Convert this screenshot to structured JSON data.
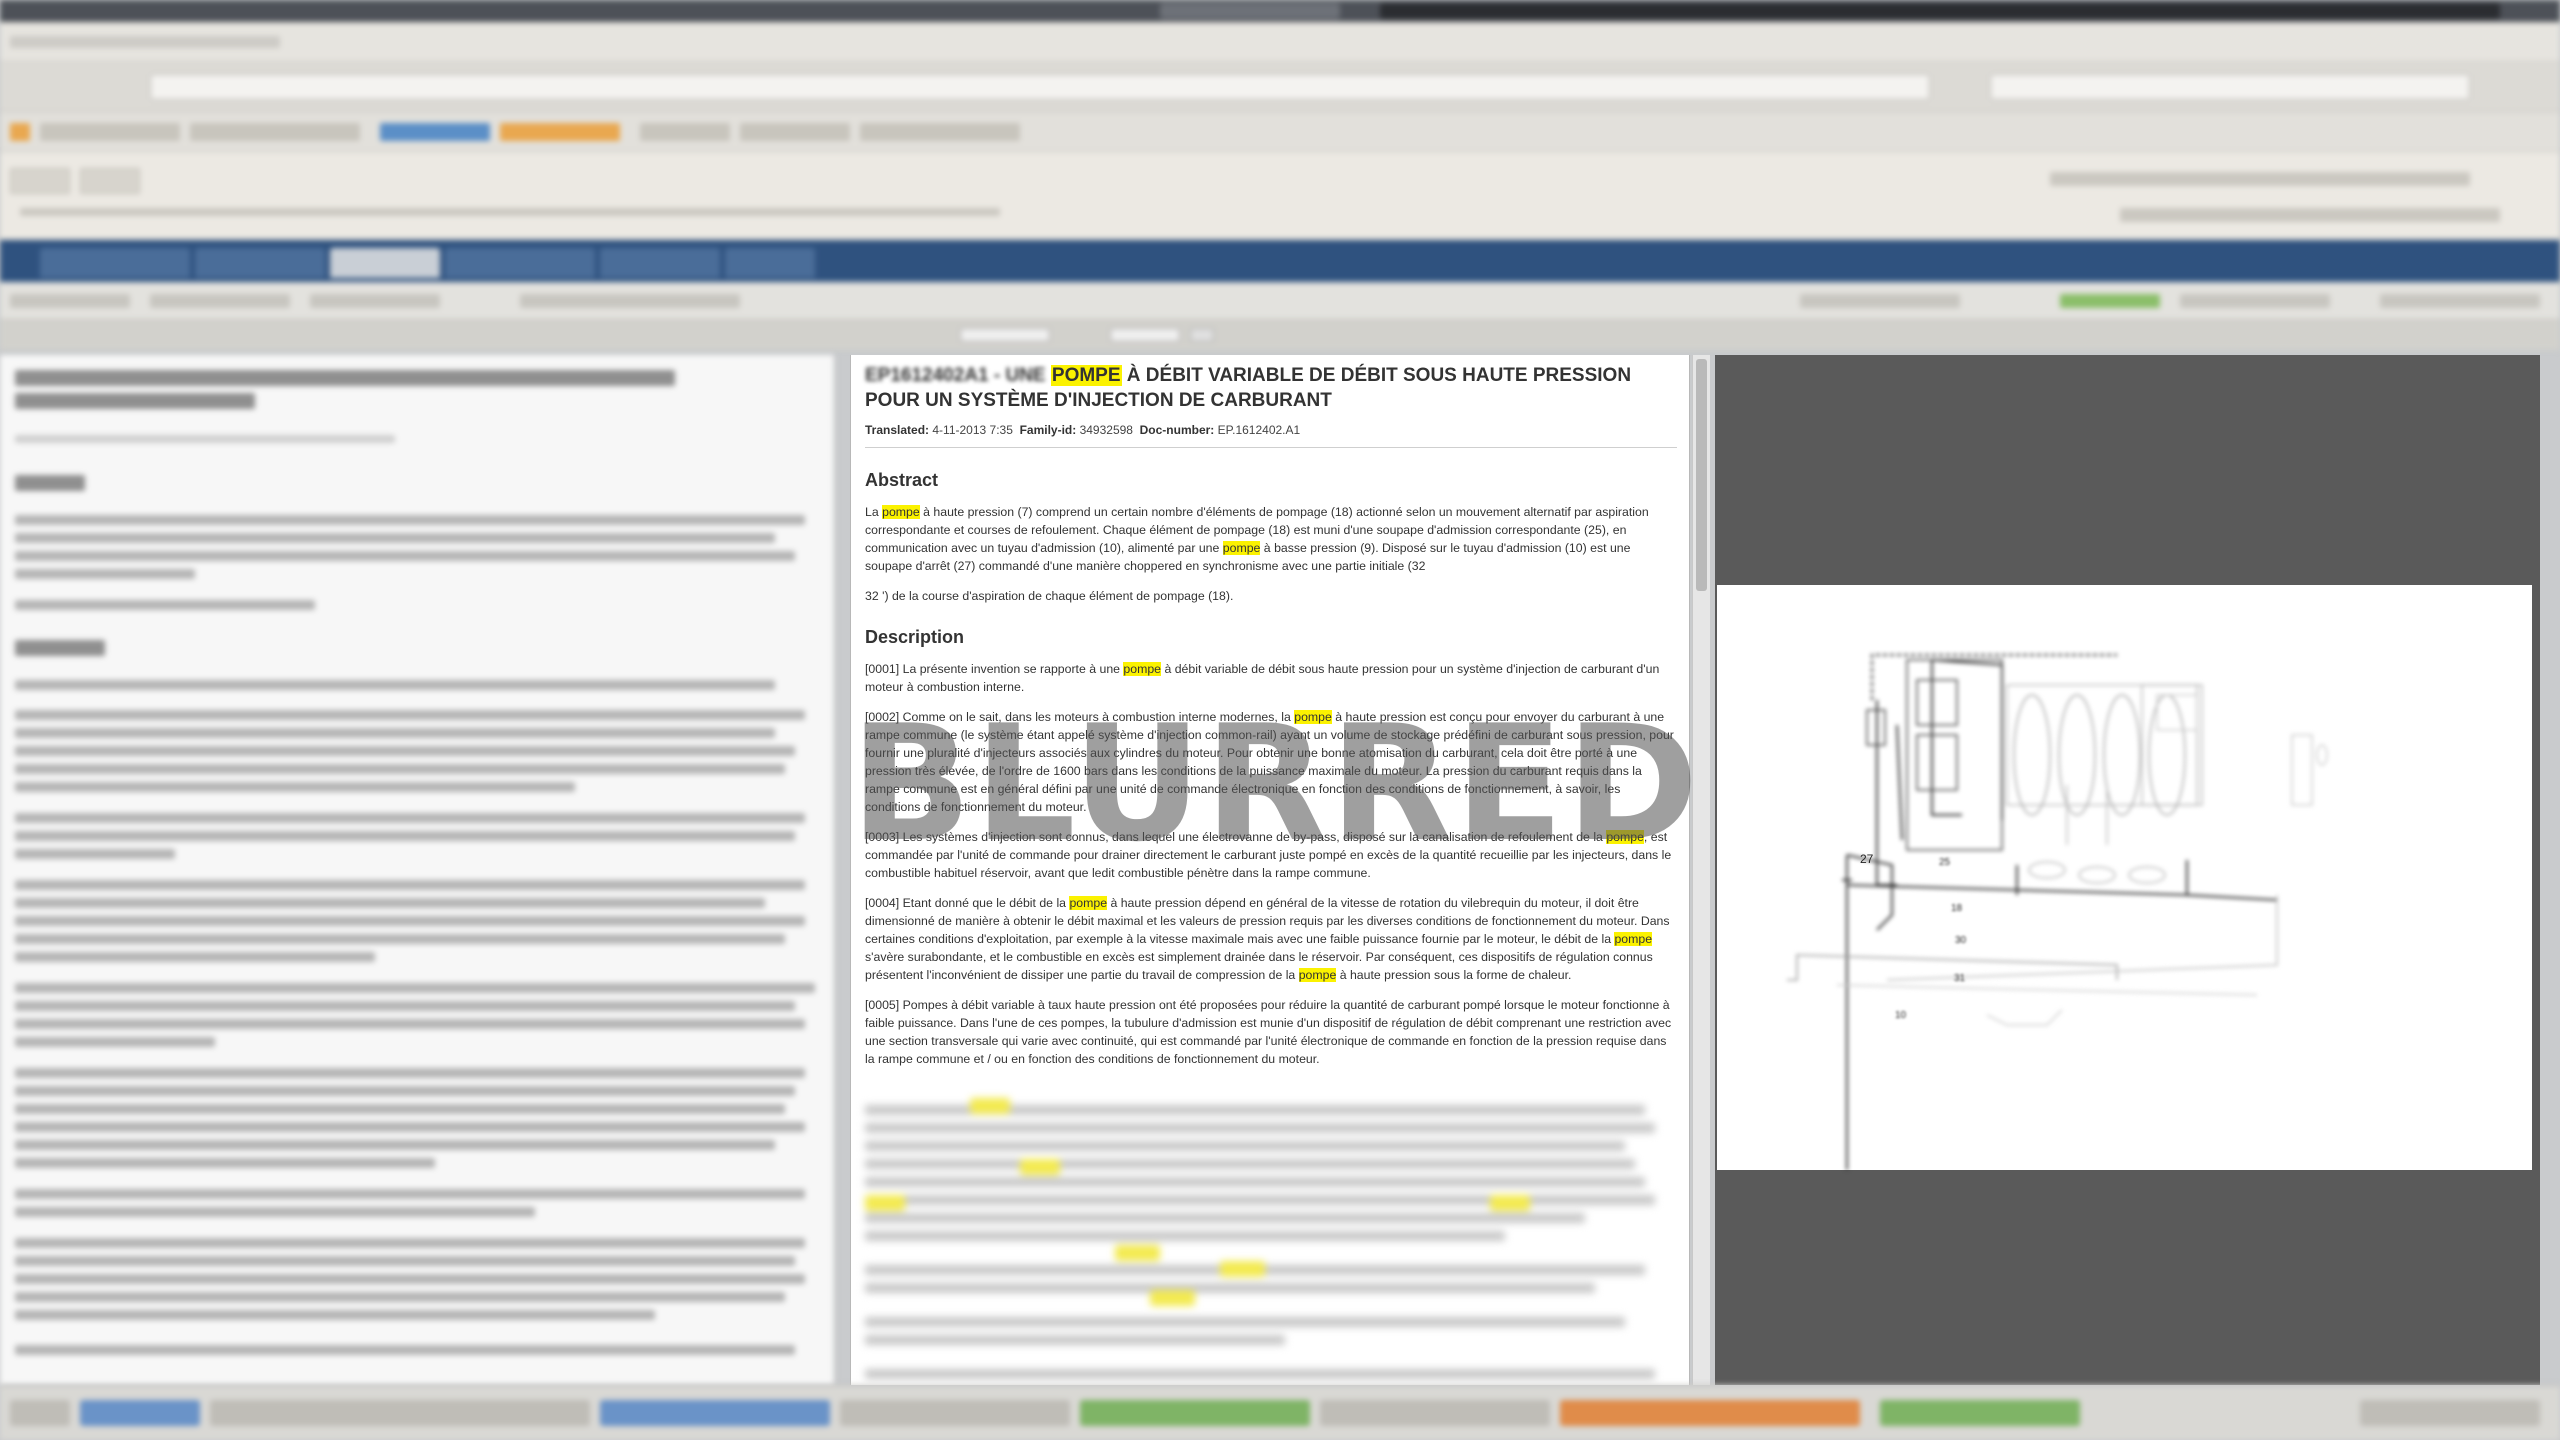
{
  "document": {
    "title_prefix": "EP1612402A1 - UNE ",
    "title_highlight": "POMPE",
    "title_rest": " À DÉBIT VARIABLE DE DÉBIT SOUS HAUTE PRESSION POUR UN SYSTÈME D'INJECTION DE CARBURANT",
    "meta": {
      "translated_label": "Translated:",
      "translated_value": "4-11-2013 7:35",
      "family_label": "Family-id:",
      "family_value": "34932598",
      "doc_label": "Doc-number:",
      "doc_value": "EP.1612402.A1"
    },
    "abstract_heading": "Abstract",
    "abstract": {
      "p1_a": "La ",
      "p1_hl1": "pompe",
      "p1_b": " à haute pression (7) comprend un certain nombre d'éléments de pompage (18) actionné selon un mouvement alternatif par aspiration correspondante et courses de refoulement. Chaque élément de pompage (18) est muni d'une soupape d'admission correspondante (25), en communication avec un tuyau d'admission (10), alimenté par une ",
      "p1_hl2": "pompe",
      "p1_c": " à basse pression (9). Disposé sur le tuyau d'admission (10) est une soupape d'arrêt (27) commandé d'une manière choppered en synchronisme avec une partie initiale (32",
      "p2": "32 ') de la course d'aspiration de chaque élément de pompage (18)."
    },
    "description_heading": "Description",
    "description": {
      "p1_a": "[0001] La présente invention se rapporte à une ",
      "p1_hl": "pompe",
      "p1_b": " à débit variable de débit sous haute pression pour un système d'injection de carburant d'un moteur à combustion interne.",
      "p2_a": "[0002] Comme on le sait, dans les moteurs à combustion interne modernes, la ",
      "p2_hl": "pompe",
      "p2_b": " à haute pression est conçu pour envoyer du carburant à une rampe commune (le système étant appelé système d'injection common-rail) ayant un volume de stockage prédéfini de carburant sous pression, pour fournir une pluralité d'injecteurs associés aux cylindres du moteur. Pour obtenir une bonne atomisation du carburant, cela doit être porté à une pression très élevée, de l'ordre de 1600 bars dans les conditions de la puissance maximale du moteur. La pression du carburant requis dans la rampe commune est en général défini par une unité de commande électronique en fonction des conditions de fonctionnement, à savoir, les conditions de fonctionnement du moteur.",
      "p3_a": "[0003] Les systèmes d'injection sont connus, dans lequel une électrovanne de by-pass, disposé sur la canalisation de refoulement de la ",
      "p3_hl": "pompe",
      "p3_b": ", est commandée par l'unité de commande pour drainer directement le carburant juste pompé en excès de la quantité recueillie par les injecteurs, dans le combustible habituel réservoir, avant que ledit combustible pénètre dans la rampe commune.",
      "p4_a": "[0004] Etant donné que le débit de la ",
      "p4_hl1": "pompe",
      "p4_b": " à haute pression dépend en général de la vitesse de rotation du vilebrequin du moteur, il doit être dimensionné de manière à obtenir le débit maximal et les valeurs de pression requis par les diverses conditions de fonctionnement du moteur. Dans certaines conditions d'exploitation, par exemple à la vitesse maximale mais avec une faible puissance fournie par le moteur, le débit de la ",
      "p4_hl2": "pompe",
      "p4_c": " s'avère surabondante, et le combustible en excès est simplement drainée dans le réservoir. Par conséquent, ces dispositifs de régulation connus présentent l'inconvénient de dissiper une partie du travail de compression de la ",
      "p4_hl3": "pompe",
      "p4_d": " à haute pression sous la forme de chaleur.",
      "p5": "[0005] Pompes à débit variable à taux haute pression ont été proposées pour réduire la quantité de carburant pompé lorsque le moteur fonctionne à faible puissance. Dans l'une de ces pompes, la tubulure d'admission est munie d'un dispositif de régulation de débit comprenant une restriction avec une section transversale qui varie avec continuité, qui est commandé par l'unité électronique de commande en fonction de la pression requise dans la rampe commune et / ou en fonction des conditions de fonctionnement du moteur."
    }
  },
  "watermark": "BLURRED",
  "drawing": {
    "labels": [
      "27",
      "25",
      "18",
      "30",
      "31",
      "10"
    ]
  },
  "colors": {
    "highlight": "#fbf200",
    "tabstrip": "#2f527f",
    "viewer_background": "#5a5a5a"
  }
}
